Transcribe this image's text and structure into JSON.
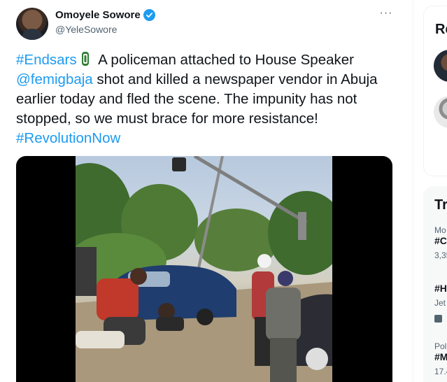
{
  "tweet": {
    "display_name": "Omoyele Sowore",
    "handle": "@YeleSowore",
    "more_glyph": "···",
    "text_parts": {
      "hashtag_endsars": "#Endsars",
      "part1": " A policeman attached to House Speaker ",
      "mention": "@femigbaja",
      "part2": " shot and killed a newspaper vendor in Abuja earlier today and fled the scene. The impunity has not stopped, so we must brace for more resistance! ",
      "hashtag_revolution": "#RevolutionNow"
    },
    "verified": true,
    "link_color": "#1d9bf0"
  },
  "sidebar": {
    "card1_heading": "Re",
    "card2_heading": "Tr",
    "trends": [
      {
        "meta": "Mo",
        "name": "#C",
        "count": "3,35"
      },
      {
        "meta": "",
        "name": "#H",
        "count": "Jet"
      },
      {
        "meta": "Poli",
        "name": "#M",
        "count": "17.4"
      }
    ]
  },
  "colors": {
    "accent": "#1d9bf0",
    "text": "#0f1419",
    "secondary": "#536471",
    "card_bg": "#f7f9f9"
  },
  "icons": {
    "verified": "verified-badge-icon",
    "more": "more-horizontal-icon",
    "nigeria_flag": "nigeria-flag-emoji",
    "promoted": "promoted-icon"
  }
}
